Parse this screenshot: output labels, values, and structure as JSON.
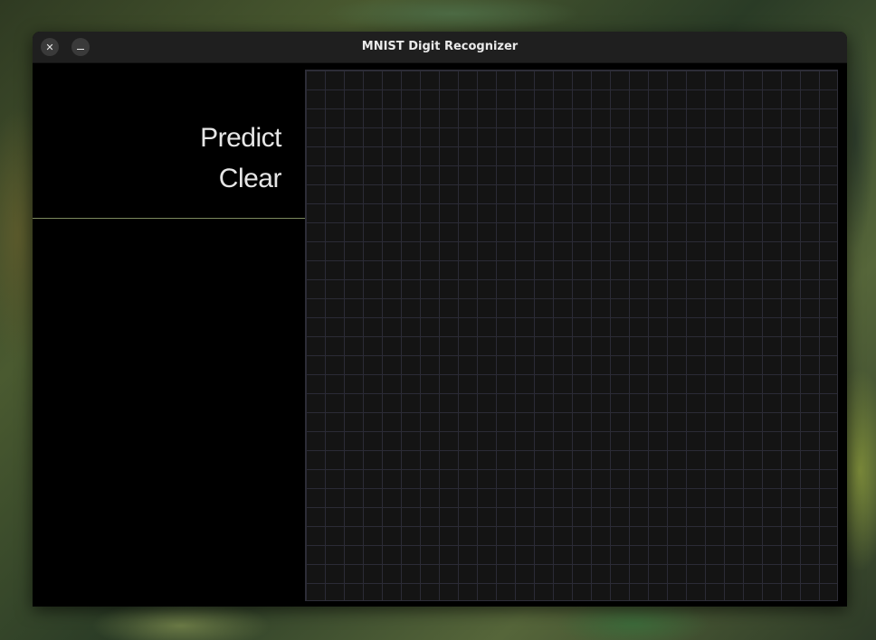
{
  "window": {
    "title": "MNIST Digit Recognizer",
    "close_glyph": "✕",
    "controls": [
      "close-icon",
      "minimize-icon"
    ]
  },
  "sidebar": {
    "predict_label": "Predict",
    "clear_label": "Clear"
  },
  "canvas": {
    "grid_cells": 28,
    "background_color": "#141414",
    "grid_color": "#2b2b36"
  },
  "colors": {
    "window_bg": "#000000",
    "titlebar_bg": "#1f1f1f",
    "text": "#e6e6e6",
    "divider": "#7d8a5e"
  }
}
